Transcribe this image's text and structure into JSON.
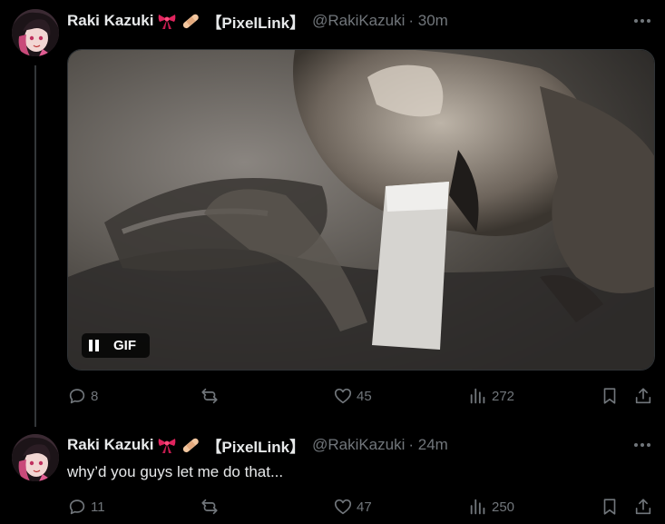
{
  "tweets": [
    {
      "author_name": "Raki Kazuki",
      "affiliation": "【PixelLink】",
      "handle": "@RakiKazuki",
      "time": "· 30m",
      "media": {
        "type": "gif",
        "badge_label": "GIF"
      },
      "stats": {
        "replies": "8",
        "retweets": "",
        "likes": "45",
        "views": "272"
      }
    },
    {
      "author_name": "Raki Kazuki",
      "affiliation": "【PixelLink】",
      "handle": "@RakiKazuki",
      "time": "· 24m",
      "text": "why’d you guys let me do that...",
      "stats": {
        "replies": "11",
        "retweets": "",
        "likes": "47",
        "views": "250"
      }
    }
  ],
  "icons": {
    "name_emojis": [
      "ribbon-icon",
      "bandage-icon"
    ],
    "actions": [
      "reply-icon",
      "retweet-icon",
      "like-icon",
      "views-icon",
      "bookmark-icon",
      "share-icon"
    ]
  },
  "colors": {
    "background": "#000000",
    "primary_text": "#e7e9ea",
    "secondary_text": "#71767b"
  }
}
